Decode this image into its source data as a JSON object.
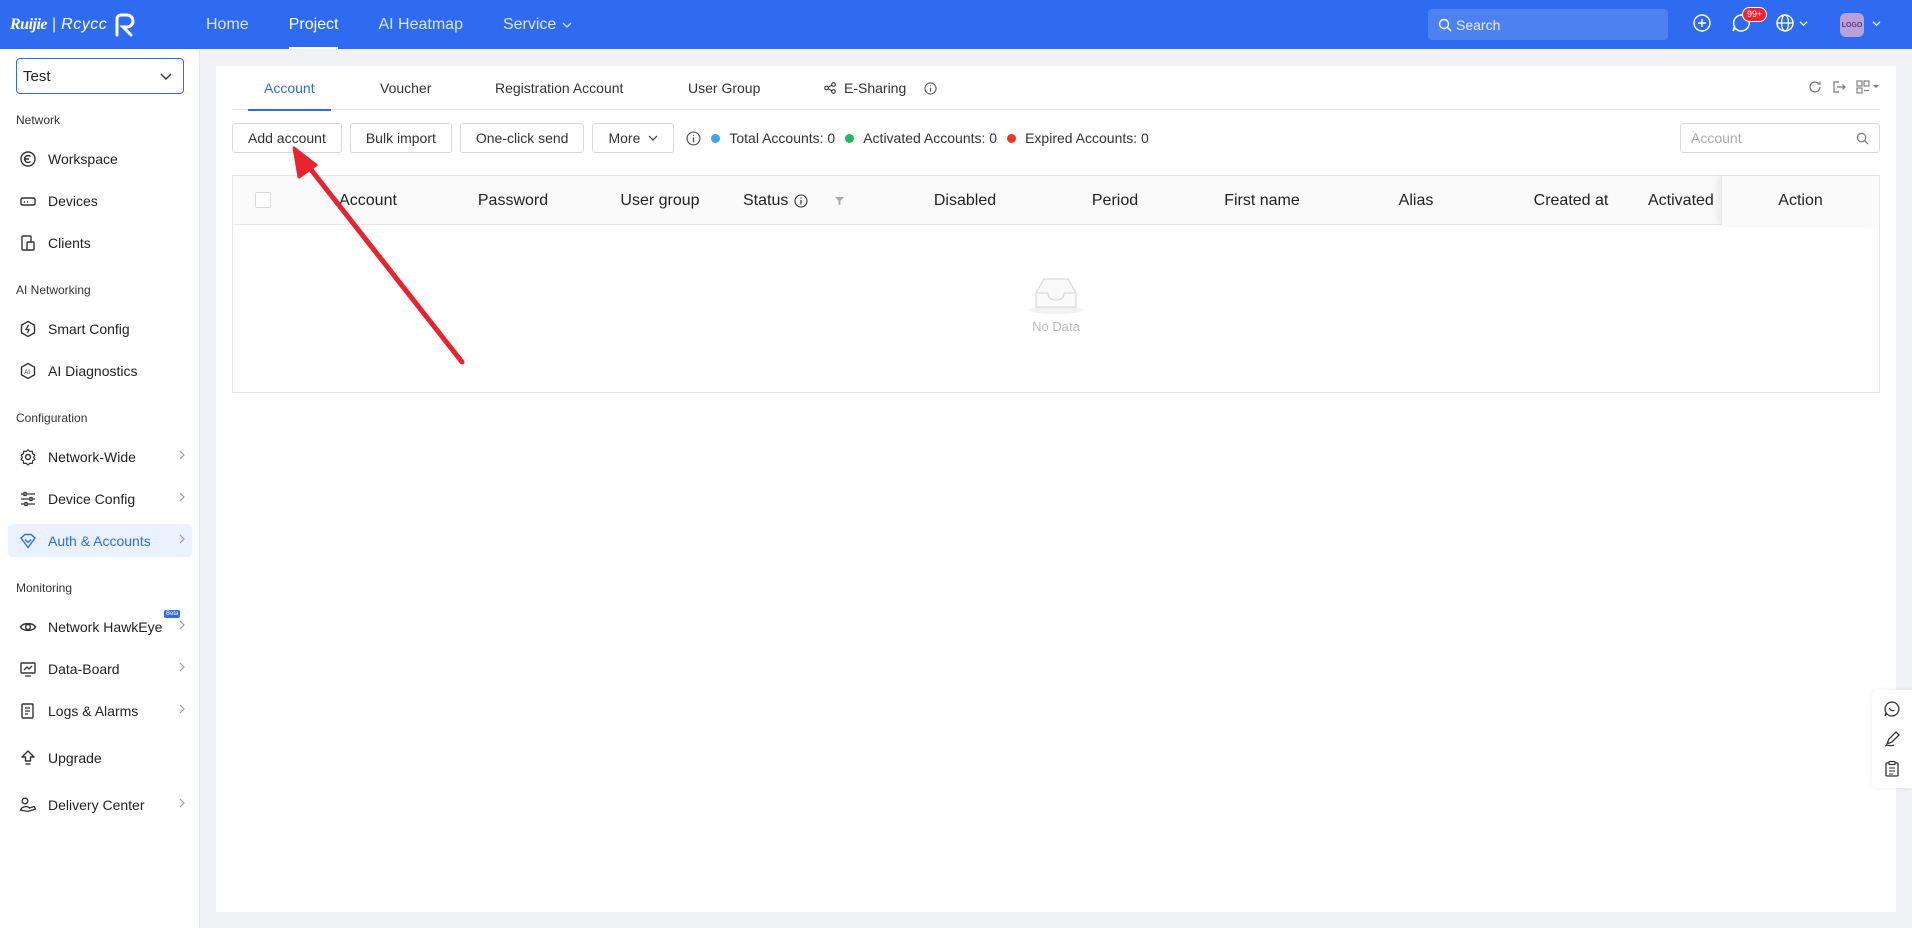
{
  "brand": {
    "part1": "Ruijie",
    "part2": "Rcycc"
  },
  "nav": {
    "items": [
      {
        "label": "Home",
        "active": false
      },
      {
        "label": "Project",
        "active": true
      },
      {
        "label": "AI Heatmap",
        "active": false
      },
      {
        "label": "Service",
        "active": false
      }
    ]
  },
  "topbar": {
    "search_placeholder": "Search",
    "notification_badge": "99+",
    "avatar_text": "LOGO",
    "accent_color": "#2e6bf0"
  },
  "sidebar": {
    "project_select": "Test",
    "sections": [
      {
        "label": "Network",
        "items": [
          {
            "label": "Workspace",
            "icon": "workspace-icon"
          },
          {
            "label": "Devices",
            "icon": "devices-icon"
          },
          {
            "label": "Clients",
            "icon": "clients-icon"
          }
        ]
      },
      {
        "label": "AI Networking",
        "items": [
          {
            "label": "Smart Config",
            "icon": "smart-config-icon"
          },
          {
            "label": "AI Diagnostics",
            "icon": "ai-diagnostics-icon"
          }
        ]
      },
      {
        "label": "Configuration",
        "items": [
          {
            "label": "Network-Wide",
            "icon": "gear-icon"
          },
          {
            "label": "Device Config",
            "icon": "sliders-icon"
          },
          {
            "label": "Auth & Accounts",
            "icon": "shield-icon",
            "active": true
          }
        ]
      },
      {
        "label": "Monitoring",
        "items": [
          {
            "label": "Network HawkEye",
            "icon": "eye-icon",
            "badge": "Beta"
          },
          {
            "label": "Data-Board",
            "icon": "dashboard-icon"
          },
          {
            "label": "Logs & Alarms",
            "icon": "logs-icon"
          },
          {
            "label": "Upgrade",
            "icon": "upgrade-icon"
          },
          {
            "label": "Delivery Center",
            "icon": "delivery-icon"
          }
        ]
      }
    ]
  },
  "tabs": [
    {
      "label": "Account",
      "active": true
    },
    {
      "label": "Voucher"
    },
    {
      "label": "Registration Account"
    },
    {
      "label": "User Group"
    },
    {
      "label": "E-Sharing"
    }
  ],
  "toolbar": {
    "add_account": "Add account",
    "bulk_import": "Bulk import",
    "one_click_send": "One-click send",
    "more": "More"
  },
  "stats": {
    "total": "Total Accounts: 0",
    "activated": "Activated Accounts: 0",
    "expired": "Expired Accounts: 0",
    "colors": {
      "total": "#3ea4f5",
      "activated": "#1fba5a",
      "expired": "#f5321e"
    }
  },
  "account_search": {
    "placeholder": "Account"
  },
  "table": {
    "columns": [
      "Account",
      "Password",
      "User group",
      "Status",
      "Disabled",
      "Period",
      "First name",
      "Alias",
      "Created at",
      "Activated",
      "Action"
    ],
    "rows": [],
    "empty_text": "No Data"
  }
}
